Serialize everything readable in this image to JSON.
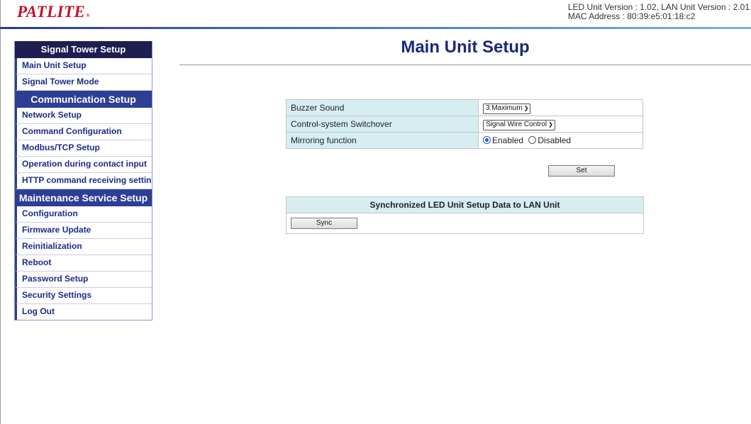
{
  "header": {
    "logo": "PATLITE",
    "logo_reg": "®",
    "version_line": "LED Unit Version : 1.02, LAN Unit Version : 2.01",
    "mac_line": "MAC Address : 80:39:e5:01:18:c2"
  },
  "sidebar": {
    "signal_tower_heading": "Signal Tower Setup",
    "signal_tower_items": [
      "Main Unit Setup",
      "Signal Tower Mode"
    ],
    "communication_heading": "Communication Setup",
    "communication_items": [
      "Network Setup",
      "Command Configuration",
      "Modbus/TCP Setup",
      "Operation during contact input",
      "HTTP command receiving settings"
    ],
    "maintenance_heading": "Maintenance Service Setup",
    "maintenance_items": [
      "Configuration",
      "Firmware Update",
      "Reinitialization",
      "Reboot",
      "Password Setup",
      "Security Settings",
      "Log Out"
    ]
  },
  "main": {
    "title": "Main Unit Setup",
    "settings": {
      "buzzer_label": "Buzzer Sound",
      "buzzer_value": "3:Maximum",
      "switchover_label": "Control-system Switchover",
      "switchover_value": "Signal Wire Control",
      "mirroring_label": "Mirroring function",
      "mirroring_enabled": "Enabled",
      "mirroring_disabled": "Disabled",
      "mirroring_selected": "Enabled"
    },
    "set_button": "Set",
    "sync": {
      "heading": "Synchronized LED Unit Setup Data to LAN Unit",
      "button": "Sync"
    }
  },
  "colors": {
    "logo_red": "#c8102e",
    "sidebar_dark": "#1e1e50",
    "sidebar_blue": "#2d3f94",
    "link_blue": "#1b2c8a",
    "table_label_bg": "#d6eef2"
  }
}
